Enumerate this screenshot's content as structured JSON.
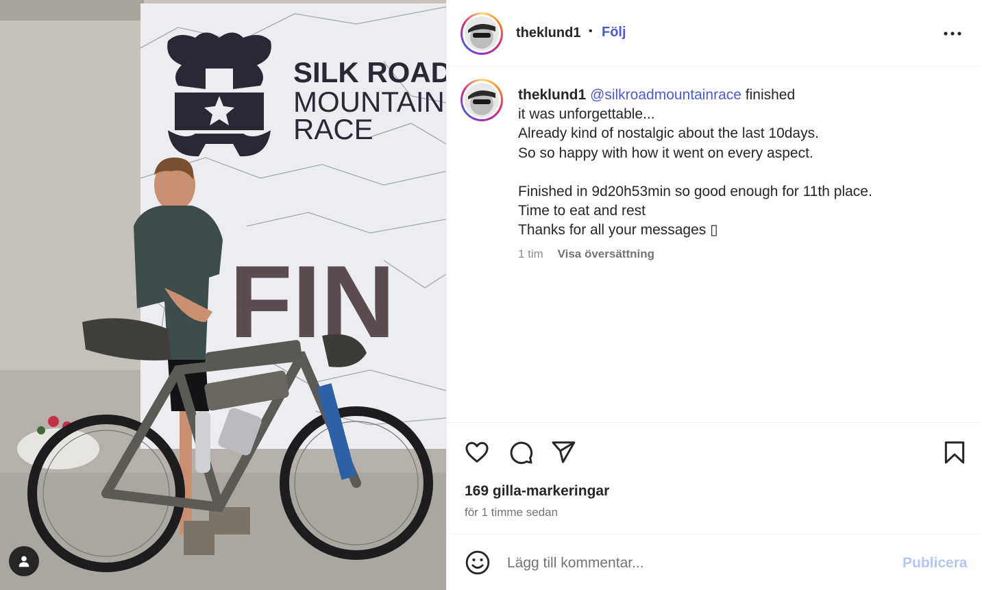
{
  "post": {
    "username": "theklund1",
    "separator": "•",
    "follow_label": "Följ",
    "more_icon": "more-horizontal-icon"
  },
  "photo": {
    "banner_line1": "SILK ROAD",
    "banner_line2": "MOUNTAIN",
    "banner_line3": "RACE",
    "banner_big": "FIN",
    "tag_icon": "user-tag-icon"
  },
  "caption": {
    "username": "theklund1",
    "mention": "@silkroadmountainrace",
    "first_line_rest": " finished",
    "lines": [
      "it was unforgettable...",
      "Already kind of nostalgic about the last 10days.",
      "So so happy with how it went on every aspect."
    ],
    "lines2": [
      "Finished in 9d20h53min so good enough for 11th place.",
      "Time to eat and rest",
      "Thanks for all your messages ▯"
    ],
    "age": "1 tim",
    "translate_label": "Visa översättning"
  },
  "actions": {
    "like_icon": "heart-icon",
    "comment_icon": "comment-icon",
    "share_icon": "send-icon",
    "save_icon": "bookmark-icon",
    "likes_text": "169 gilla-markeringar",
    "timestamp": "för 1 timme sedan"
  },
  "comment": {
    "placeholder": "Lägg till kommentar...",
    "publish_label": "Publicera",
    "emoji_icon": "emoji-icon"
  },
  "colors": {
    "link": "#4a5ad8",
    "publish_disabled": "#b3c7f7",
    "muted": "#737373"
  }
}
